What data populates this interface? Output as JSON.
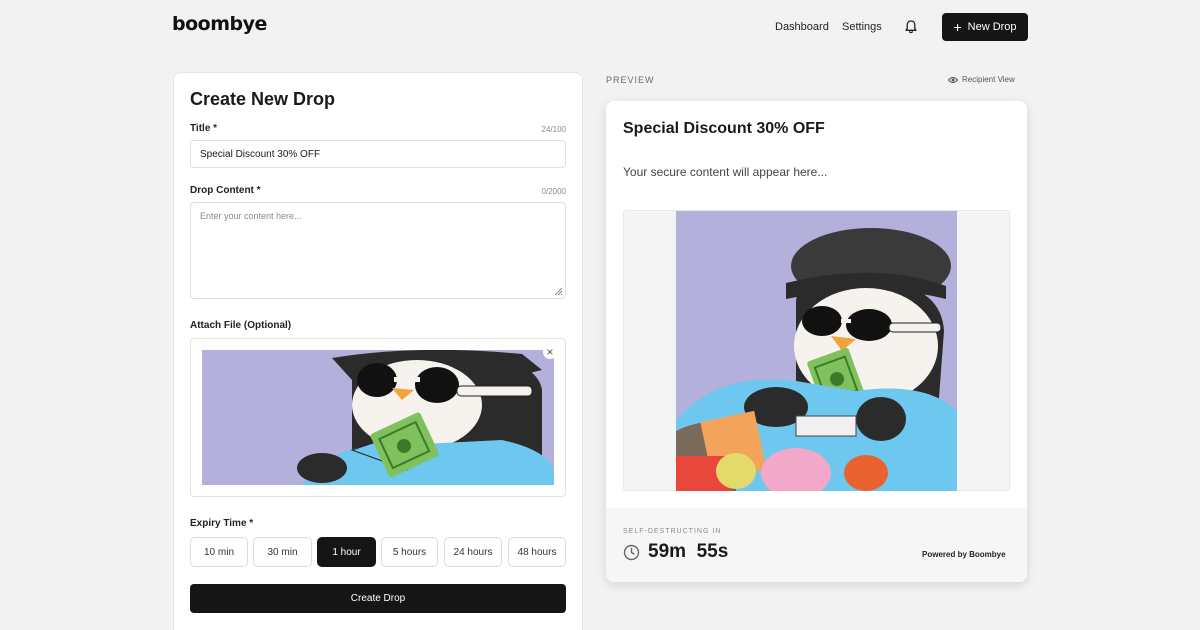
{
  "header": {
    "logo": "boombye",
    "nav": [
      "Dashboard",
      "Settings"
    ],
    "new_drop_label": "New Drop",
    "plus": "+"
  },
  "form": {
    "heading": "Create New Drop",
    "title_label": "Title *",
    "title_counter": "24/100",
    "title_value": "Special Discount 30% OFF",
    "content_label": "Drop Content *",
    "content_counter": "0/2000",
    "content_placeholder": "Enter your content here...",
    "attach_label": "Attach File (Optional)",
    "close": "×",
    "expiry_label": "Expiry Time *",
    "expiry_options": [
      "10 min",
      "30 min",
      "1 hour",
      "5 hours",
      "24 hours",
      "48 hours"
    ],
    "expiry_selected": "1 hour",
    "create_label": "Create Drop"
  },
  "preview": {
    "label": "PREVIEW",
    "recipient_view": "Recipient View",
    "title": "Special Discount 30% OFF",
    "body": "Your secure content will appear here...",
    "self_destruct_label": "SELF-DESTRUCTING IN",
    "timer": "59m  55s",
    "powered_by": "Powered by Boombye"
  },
  "icons": {
    "bell": "bell-icon",
    "plus": "plus-icon",
    "eye": "eye-icon",
    "close": "close-icon",
    "clock": "clock-icon",
    "resize": "resize-handle-icon"
  },
  "colors": {
    "accent": "#151515",
    "background": "#f2f2f2",
    "image_bg": "#b4b0dc"
  }
}
